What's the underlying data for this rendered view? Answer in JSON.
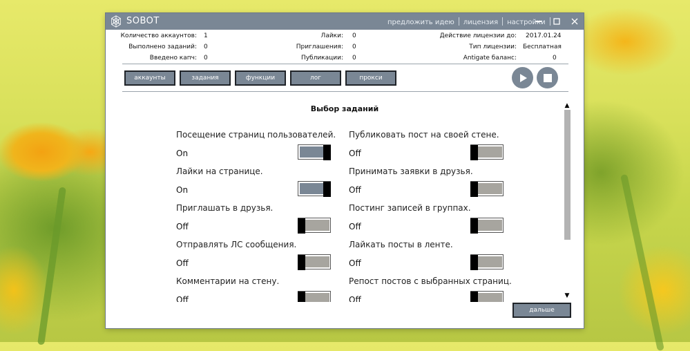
{
  "app": {
    "title": "SOBOT",
    "menu": [
      "предложить идею",
      "лицензия",
      "настройки"
    ]
  },
  "stats": {
    "left": [
      {
        "label": "Количество аккаунтов:",
        "value": "1"
      },
      {
        "label": "Выполнено заданий:",
        "value": "0"
      },
      {
        "label": "Введено капч:",
        "value": "0"
      }
    ],
    "middle": [
      {
        "label": "Лайки:",
        "value": "0"
      },
      {
        "label": "Приглашения:",
        "value": "0"
      },
      {
        "label": "Публикации:",
        "value": "0"
      }
    ],
    "right": [
      {
        "label": "Действие лицензии до:",
        "value": "2017.01.24"
      },
      {
        "label": "Тип лицензии:",
        "value": "Бесплатная"
      },
      {
        "label": "Antigate баланс:",
        "value": "0"
      }
    ]
  },
  "tabs": [
    "аккаунты",
    "задания",
    "функции",
    "лог",
    "прокси"
  ],
  "section": {
    "title": "Выбор заданий"
  },
  "tasks": {
    "left": [
      {
        "label": "Посещение страниц пользователей.",
        "state": "On"
      },
      {
        "label": "Лайки на странице.",
        "state": "On"
      },
      {
        "label": "Приглашать в друзья.",
        "state": "Off"
      },
      {
        "label": "Отправлять ЛС сообщения.",
        "state": "Off"
      },
      {
        "label": "Комментарии на стену.",
        "state": "Off"
      }
    ],
    "right": [
      {
        "label": "Публиковать пост на своей стене.",
        "state": "Off"
      },
      {
        "label": "Принимать заявки в друзья.",
        "state": "Off"
      },
      {
        "label": "Постинг записей в группах.",
        "state": "Off"
      },
      {
        "label": "Лайкать посты в ленте.",
        "state": "Off"
      },
      {
        "label": "Репост постов с выбранных страниц.",
        "state": "Off"
      }
    ]
  },
  "buttons": {
    "next": "дальше"
  },
  "colors": {
    "titlebar": "#7a8795",
    "tab_fill": "#7a8795",
    "toggle_on": "#7a8795",
    "toggle_off": "#a7a59f",
    "knob": "#000000"
  },
  "icons": {
    "logo": "spider-web-icon",
    "play": "play-icon",
    "stop": "stop-icon",
    "minimize": "minimize-icon",
    "maximize": "maximize-icon",
    "close": "close-icon"
  }
}
